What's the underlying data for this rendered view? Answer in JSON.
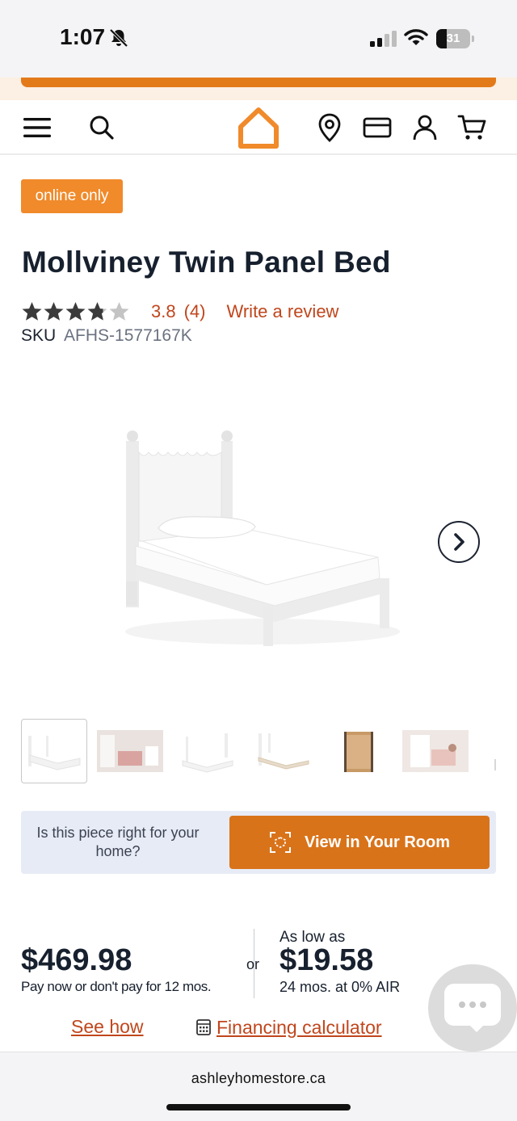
{
  "status_bar": {
    "time": "1:07",
    "battery_level": "31",
    "battery_fraction": 0.31,
    "icons": [
      "bell-off-icon",
      "signal-icon",
      "wifi-icon",
      "battery-icon"
    ]
  },
  "header": {
    "icons": [
      "menu-icon",
      "search-icon",
      "home-logo-icon",
      "location-pin-icon",
      "credit-card-icon",
      "account-icon",
      "cart-icon"
    ],
    "brand_color": "#f08a2a"
  },
  "product": {
    "badge": "online only",
    "title": "Mollviney Twin Panel Bed",
    "rating": 3.8,
    "rating_text": "3.8",
    "review_count_text": "(4)",
    "write_review": "Write a review",
    "sku_label": "SKU",
    "sku_value": "AFHS-1577167K",
    "image_count": 6,
    "active_thumbnail": 1
  },
  "view_in_room": {
    "question": "Is this piece right for your home?",
    "button_label": "View in Your Room"
  },
  "pricing": {
    "price": "$469.98",
    "pay_later": "Pay now or don't pay for 12 mos.",
    "or": "or",
    "as_low_as": "As low as",
    "monthly": "$19.58",
    "terms": "24 mos. at 0% AIR",
    "see_how": "See how",
    "financing_calculator": "Financing calculator"
  },
  "colors": {
    "accent_orange": "#d9731a",
    "link_red": "#c0461c",
    "text_dark": "#17202e"
  },
  "browser": {
    "url": "ashleyhomestore.ca"
  }
}
